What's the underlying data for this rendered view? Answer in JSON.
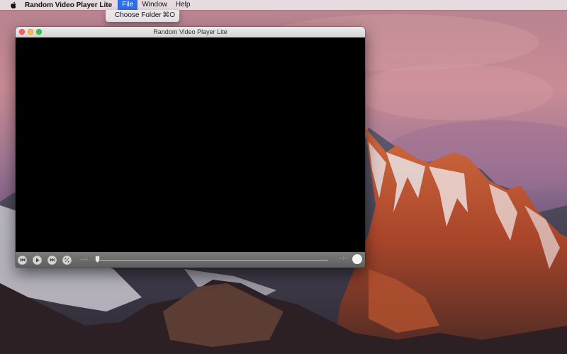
{
  "menubar": {
    "apple_icon": "apple-logo-icon",
    "app_name": "Random Video Player Lite",
    "items": [
      {
        "label": "File",
        "active": true
      },
      {
        "label": "Window",
        "active": false
      },
      {
        "label": "Help",
        "active": false
      }
    ],
    "accent": "#2f6de3"
  },
  "file_menu": {
    "items": [
      {
        "label": "Choose Folder",
        "shortcut": "⌘O"
      }
    ]
  },
  "window": {
    "title": "Random Video Player Lite",
    "controls": {
      "previous_icon": "skip-back-icon",
      "play_icon": "play-icon",
      "next_icon": "skip-forward-icon",
      "fullscreen_icon": "fullscreen-icon",
      "elapsed": "--:--",
      "remaining": "--:--",
      "progress": 0
    }
  }
}
